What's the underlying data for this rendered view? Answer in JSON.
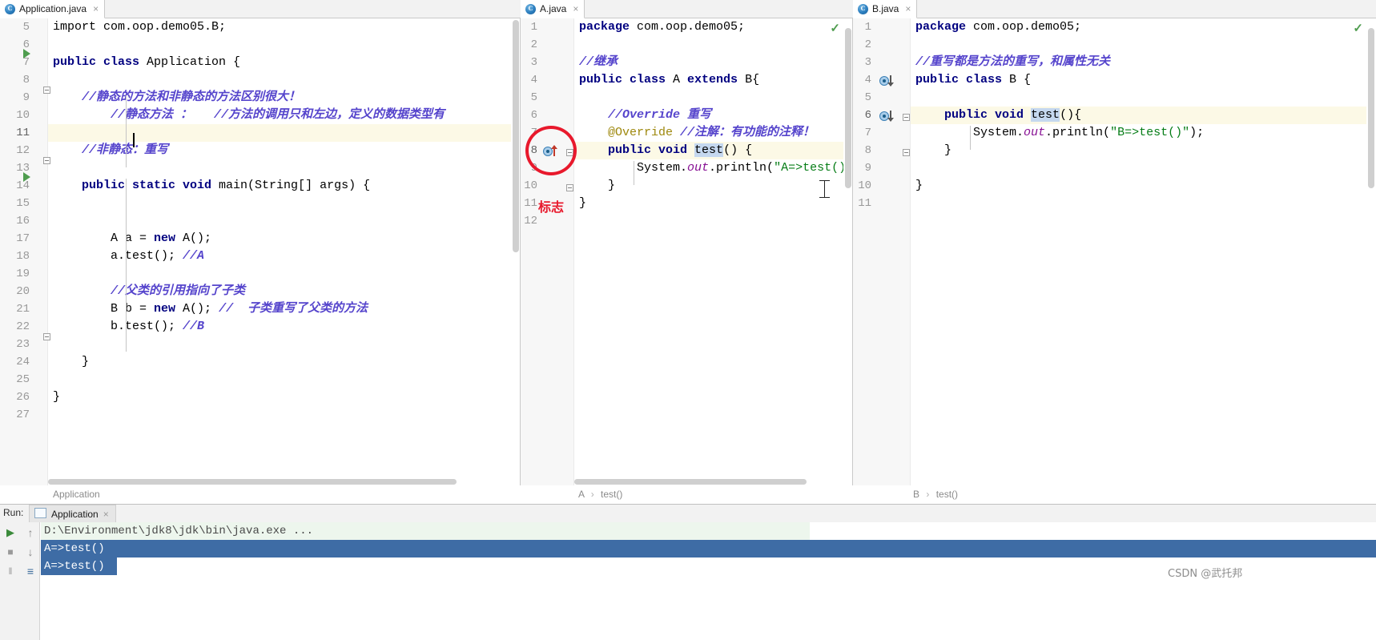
{
  "editors": [
    {
      "tab": {
        "label": "Application.java",
        "icon": "java-class-icon",
        "close": "×"
      },
      "breadcrumb": {
        "parts": [
          "Application"
        ]
      },
      "first_line_number": 5,
      "lines": [
        {
          "n": 5,
          "segments": [
            {
              "t": "import com.oop.demo05.B;",
              "c": "plain"
            }
          ]
        },
        {
          "n": 6,
          "segments": []
        },
        {
          "n": 7,
          "segments": [
            {
              "t": "public class ",
              "c": "kw"
            },
            {
              "t": "Application {",
              "c": "plain"
            }
          ]
        },
        {
          "n": 8,
          "segments": []
        },
        {
          "n": 9,
          "segments": [
            {
              "t": "    //静态的方法和非静态的方法区别很大！",
              "c": "cmt"
            }
          ]
        },
        {
          "n": 10,
          "segments": [
            {
              "t": "        //静态方法 ：   //方法的调用只和左边，定义的数据类型有",
              "c": "cmt"
            }
          ]
        },
        {
          "n": 11,
          "segments": []
        },
        {
          "n": 12,
          "segments": [
            {
              "t": "    //非静态：重写",
              "c": "cmt"
            }
          ]
        },
        {
          "n": 13,
          "segments": []
        },
        {
          "n": 14,
          "segments": [
            {
              "t": "    ",
              "c": "plain"
            },
            {
              "t": "public static void ",
              "c": "kw"
            },
            {
              "t": "main(String[] args) {",
              "c": "plain"
            }
          ]
        },
        {
          "n": 15,
          "segments": []
        },
        {
          "n": 16,
          "segments": []
        },
        {
          "n": 17,
          "segments": [
            {
              "t": "        A a = ",
              "c": "plain"
            },
            {
              "t": "new ",
              "c": "kw"
            },
            {
              "t": "A();",
              "c": "plain"
            }
          ]
        },
        {
          "n": 18,
          "segments": [
            {
              "t": "        a.test(); ",
              "c": "plain"
            },
            {
              "t": "//A",
              "c": "cmt"
            }
          ]
        },
        {
          "n": 19,
          "segments": []
        },
        {
          "n": 20,
          "segments": [
            {
              "t": "        //父类的引用指向了子类",
              "c": "cmt"
            }
          ]
        },
        {
          "n": 21,
          "segments": [
            {
              "t": "        B b = ",
              "c": "plain"
            },
            {
              "t": "new ",
              "c": "kw"
            },
            {
              "t": "A(); ",
              "c": "plain"
            },
            {
              "t": "//  子类重写了父类的方法",
              "c": "cmt"
            }
          ]
        },
        {
          "n": 22,
          "segments": [
            {
              "t": "        b.test(); ",
              "c": "plain"
            },
            {
              "t": "//B",
              "c": "cmt"
            }
          ]
        },
        {
          "n": 23,
          "segments": []
        },
        {
          "n": 24,
          "segments": [
            {
              "t": "    }",
              "c": "plain"
            }
          ]
        },
        {
          "n": 25,
          "segments": []
        },
        {
          "n": 26,
          "segments": [
            {
              "t": "}",
              "c": "plain"
            }
          ]
        },
        {
          "n": 27,
          "segments": []
        }
      ]
    },
    {
      "tab": {
        "label": "A.java",
        "icon": "java-class-icon",
        "close": "×"
      },
      "breadcrumb": {
        "parts": [
          "A",
          "test()"
        ]
      },
      "first_line_number": 1,
      "lines": [
        {
          "n": 1,
          "segments": [
            {
              "t": "package ",
              "c": "kw"
            },
            {
              "t": "com.oop.demo05;",
              "c": "plain"
            }
          ]
        },
        {
          "n": 2,
          "segments": []
        },
        {
          "n": 3,
          "segments": [
            {
              "t": "//继承",
              "c": "cmt"
            }
          ]
        },
        {
          "n": 4,
          "segments": [
            {
              "t": "public class ",
              "c": "kw"
            },
            {
              "t": "A ",
              "c": "plain"
            },
            {
              "t": "extends ",
              "c": "kw"
            },
            {
              "t": "B{",
              "c": "plain"
            }
          ]
        },
        {
          "n": 5,
          "segments": []
        },
        {
          "n": 6,
          "segments": [
            {
              "t": "    //Override 重写",
              "c": "cmt"
            }
          ]
        },
        {
          "n": 7,
          "segments": [
            {
              "t": "    @Override ",
              "c": "anno"
            },
            {
              "t": "//注解：有功能的注释！",
              "c": "cmt"
            }
          ]
        },
        {
          "n": 8,
          "segments": [
            {
              "t": "    ",
              "c": "plain"
            },
            {
              "t": "public void ",
              "c": "kw"
            },
            {
              "t": "test",
              "c": "sel"
            },
            {
              "t": "() {",
              "c": "plain"
            }
          ]
        },
        {
          "n": 9,
          "segments": [
            {
              "t": "        System.",
              "c": "plain"
            },
            {
              "t": "out",
              "c": "fld"
            },
            {
              "t": ".println(",
              "c": "plain"
            },
            {
              "t": "\"A=>test()\"",
              "c": "str"
            },
            {
              "t": ");",
              "c": "plain"
            }
          ]
        },
        {
          "n": 10,
          "segments": [
            {
              "t": "    }",
              "c": "plain"
            }
          ]
        },
        {
          "n": 11,
          "segments": [
            {
              "t": "}",
              "c": "plain"
            }
          ]
        },
        {
          "n": 12,
          "segments": []
        }
      ]
    },
    {
      "tab": {
        "label": "B.java",
        "icon": "java-class-icon",
        "close": "×"
      },
      "breadcrumb": {
        "parts": [
          "B",
          "test()"
        ]
      },
      "first_line_number": 1,
      "lines": [
        {
          "n": 1,
          "segments": [
            {
              "t": "package ",
              "c": "kw"
            },
            {
              "t": "com.oop.demo05;",
              "c": "plain"
            }
          ]
        },
        {
          "n": 2,
          "segments": []
        },
        {
          "n": 3,
          "segments": [
            {
              "t": "//重写都是方法的重写，和属性无关",
              "c": "cmt"
            }
          ]
        },
        {
          "n": 4,
          "segments": [
            {
              "t": "public class ",
              "c": "kw"
            },
            {
              "t": "B {",
              "c": "plain"
            }
          ]
        },
        {
          "n": 5,
          "segments": []
        },
        {
          "n": 6,
          "segments": [
            {
              "t": "    ",
              "c": "plain"
            },
            {
              "t": "public void ",
              "c": "kw"
            },
            {
              "t": "test",
              "c": "sel"
            },
            {
              "t": "(){",
              "c": "plain"
            }
          ]
        },
        {
          "n": 7,
          "segments": [
            {
              "t": "        System.",
              "c": "plain"
            },
            {
              "t": "out",
              "c": "fld"
            },
            {
              "t": ".println(",
              "c": "plain"
            },
            {
              "t": "\"B=>test()\"",
              "c": "str"
            },
            {
              "t": ");",
              "c": "plain"
            }
          ]
        },
        {
          "n": 8,
          "segments": [
            {
              "t": "    }",
              "c": "plain"
            }
          ]
        },
        {
          "n": 9,
          "segments": []
        },
        {
          "n": 10,
          "segments": [
            {
              "t": "}",
              "c": "plain"
            }
          ]
        },
        {
          "n": 11,
          "segments": []
        }
      ]
    }
  ],
  "annotation": {
    "label": "标志",
    "color": "#e8192c",
    "target": "override-gutter-icon-line-8"
  },
  "run_window": {
    "label": "Run:",
    "tab": {
      "label": "Application",
      "icon": "run-config-icon",
      "close": "×"
    },
    "toolbar": [
      {
        "name": "rerun-button",
        "glyph": "▶"
      },
      {
        "name": "stop-button",
        "glyph": "■"
      },
      {
        "name": "pause-button",
        "glyph": "‖"
      },
      {
        "name": "scroll-up-button",
        "glyph": "↑"
      },
      {
        "name": "scroll-down-button",
        "glyph": "↓"
      },
      {
        "name": "soft-wrap-button",
        "glyph": "≡"
      }
    ],
    "console_lines": [
      {
        "text": "D:\\Environment\\jdk8\\jdk\\bin\\java.exe ...",
        "style": "cmdline"
      },
      {
        "text": "A=>test()",
        "style": "outsel"
      },
      {
        "text": "A=>test()",
        "style": "outsel"
      }
    ]
  },
  "watermark": "CSDN @武托邦",
  "colors": {
    "keyword": "#000080",
    "comment": "#5544cc",
    "string": "#067d17",
    "annotation": "#9e880d",
    "field": "#871094",
    "selection": "#c5d8ef",
    "current_line": "#fcf9e6",
    "console_selection": "#3e6ca5",
    "annotation_red": "#e8192c"
  }
}
